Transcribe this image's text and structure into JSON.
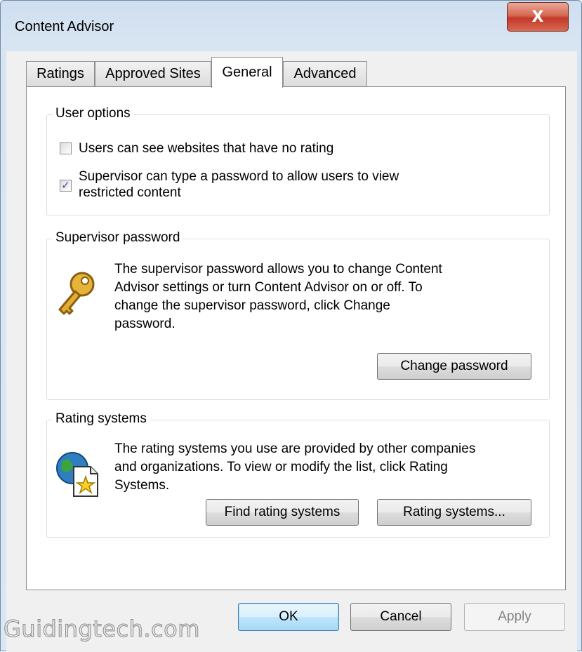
{
  "window": {
    "title": "Content Advisor",
    "close_glyph": "X"
  },
  "tabs": [
    {
      "label": "Ratings"
    },
    {
      "label": "Approved Sites"
    },
    {
      "label": "General"
    },
    {
      "label": "Advanced"
    }
  ],
  "user_options": {
    "title": "User options",
    "option1": {
      "label": "Users can see websites that have no rating",
      "checked": false
    },
    "option2": {
      "line1": "Supervisor can type a password to allow users to view",
      "line2": "restricted content",
      "checked": true,
      "mark": "✓"
    }
  },
  "supervisor": {
    "title": "Supervisor password",
    "line1": "The supervisor password allows you to change Content",
    "line2": "Advisor settings or turn Content Advisor on or off. To",
    "line3": "change the supervisor password, click Change",
    "line4": "password.",
    "change_button": "Change password",
    "icon": "key-icon"
  },
  "rating_systems": {
    "title": "Rating systems",
    "line1": "The rating systems you use are provided by other companies",
    "line2": "and organizations. To view or modify the list, click Rating",
    "line3": "Systems.",
    "find_button": "Find rating systems",
    "systems_button": "Rating systems...",
    "icon": "globe-star-icon"
  },
  "footer": {
    "ok": "OK",
    "cancel": "Cancel",
    "apply": "Apply"
  },
  "watermark": "Guidingtech.com"
}
